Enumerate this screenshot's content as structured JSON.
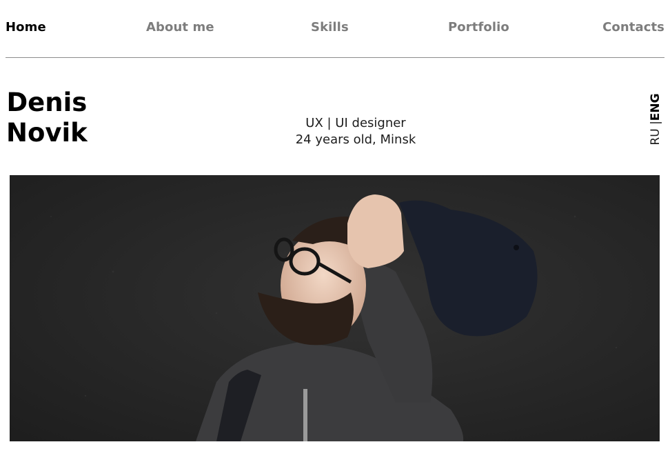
{
  "nav": {
    "items": [
      {
        "label": "Home",
        "active": true
      },
      {
        "label": "About me",
        "active": false
      },
      {
        "label": "Skills",
        "active": false
      },
      {
        "label": "Portfolio",
        "active": false
      },
      {
        "label": "Contacts",
        "active": false
      }
    ]
  },
  "profile": {
    "first_name": "Denis",
    "last_name": "Novik",
    "role": "UX | UI designer",
    "details": "24 years old, Minsk"
  },
  "language": {
    "ru": "RU",
    "separator": "|",
    "eng": "ENG",
    "selected": "ENG"
  },
  "colors": {
    "nav_active": "#000000",
    "nav_inactive": "#7d7d7d",
    "divider": "#8c8c8c",
    "hero_background": "#262626"
  }
}
